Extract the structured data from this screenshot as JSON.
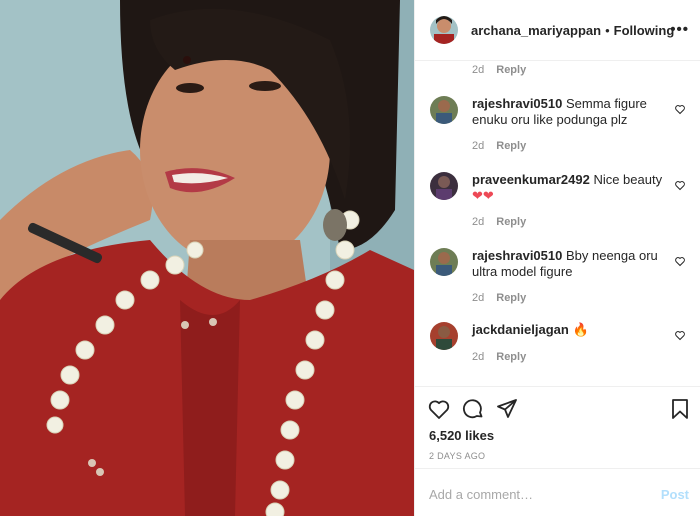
{
  "post": {
    "author": "archana_mariyappan",
    "separator": "•",
    "follow_status": "Following",
    "more_label": "•••",
    "caption_meta": {
      "time": "2d",
      "reply": "Reply"
    }
  },
  "comments": [
    {
      "user": "rajeshravi0510",
      "text": "Semma figure enuku oru like podunga plz",
      "time": "2d",
      "reply": "Reply"
    },
    {
      "user": "praveenkumar2492",
      "text": "Nice beauty",
      "emoji": "❤❤",
      "time": "2d",
      "reply": "Reply"
    },
    {
      "user": "rajeshravi0510",
      "text": "Bby neenga oru ultra model figure",
      "time": "2d",
      "reply": "Reply"
    },
    {
      "user": "jackdanieljagan",
      "text": "",
      "emoji": "🔥",
      "time": "2d",
      "reply": "Reply"
    }
  ],
  "actions": {
    "likes": "6,520 likes",
    "date": "2 DAYS AGO",
    "icons": [
      "heart-icon",
      "comment-icon",
      "share-icon",
      "bookmark-icon"
    ]
  },
  "add_comment": {
    "placeholder": "Add a comment…",
    "post_label": "Post"
  },
  "colors": {
    "post_button_disabled": "#b2dffc",
    "muted_text": "#8e8e8e",
    "emoji_heart": "#ed4956"
  }
}
